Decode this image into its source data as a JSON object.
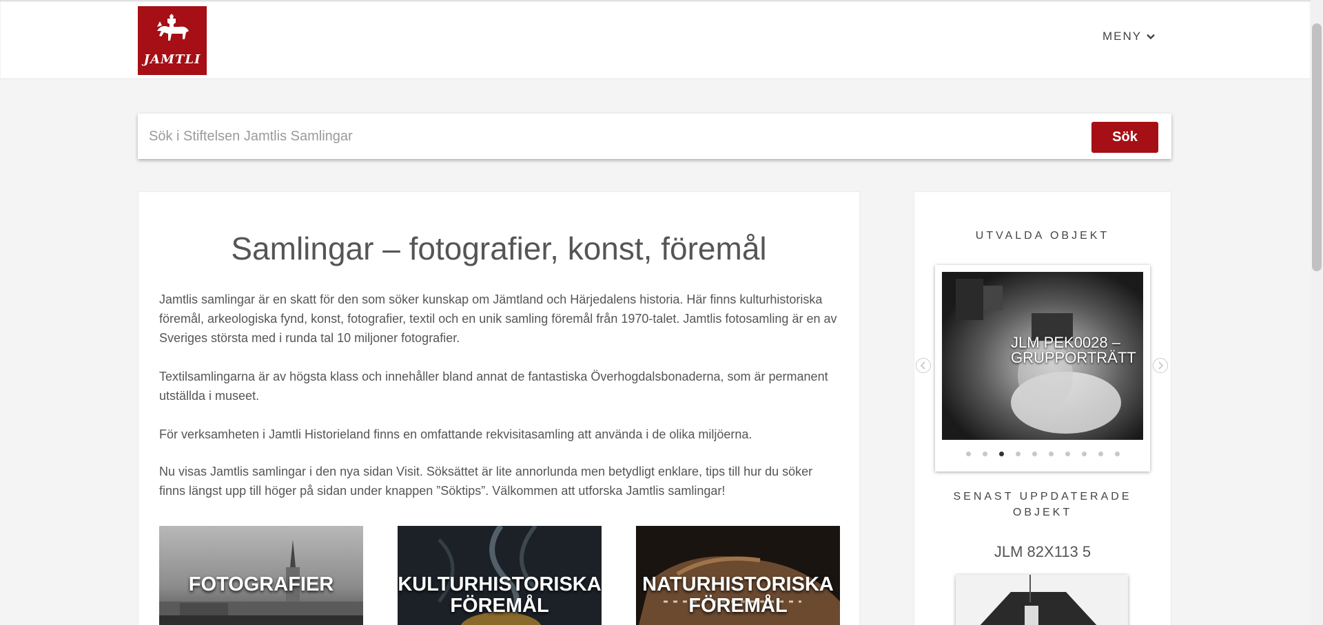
{
  "header": {
    "logo_text": "JAMTLI",
    "menu_label": "MENY",
    "brand_color": "#a50f15"
  },
  "search": {
    "placeholder": "Sök i Stiftelsen Jamtlis Samlingar",
    "value": "",
    "button_label": "Sök"
  },
  "main": {
    "title": "Samlingar – fotografier, konst, föremål",
    "paragraphs": [
      "Jamtlis samlingar är en skatt för den som söker kunskap om Jämtland och Härjedalens historia. Här finns kulturhistoriska föremål, arkeologiska fynd, konst, fotografier, textil och en unik samling föremål från 1970-talet. Jamtlis fotosamling är en av Sveriges största med i runda tal 10 miljoner fotografier.",
      "Textilsamlingarna är av högsta klass och innehåller bland annat de fantastiska Överhogdalsbonaderna, som är permanent utställda i museet.",
      "För verksamheten i Jamtli Historieland finns en omfattande rekvisitasamling att använda i de olika miljöerna.",
      "Nu visas Jamtlis samlingar i den nya sidan Visit. Söksättet är lite annorlunda men betydligt enklare, tips till hur du söker finns längst upp till höger på sidan under knappen ”Söktips”. Välkommen att utforska Jamtlis samlingar!"
    ],
    "tiles": [
      {
        "label": "FOTOGRAFIER"
      },
      {
        "label": "KULTURHISTORISKA FÖREMÅL"
      },
      {
        "label": "NATURHISTORISKA FÖREMÅL"
      }
    ]
  },
  "sidebar": {
    "featured_heading": "UTVALDA OBJEKT",
    "featured_caption": "JLM PEK0028 – Grupporträtt",
    "carousel_dot_count": 10,
    "carousel_active_index": 2,
    "recent_heading": "SENAST UPPDATERADE OBJEKT",
    "recent_title": "JLM 82X113 5"
  },
  "icons": {
    "menu": "chevron-down-icon",
    "prev": "chevron-left-icon",
    "next": "chevron-right-icon"
  }
}
